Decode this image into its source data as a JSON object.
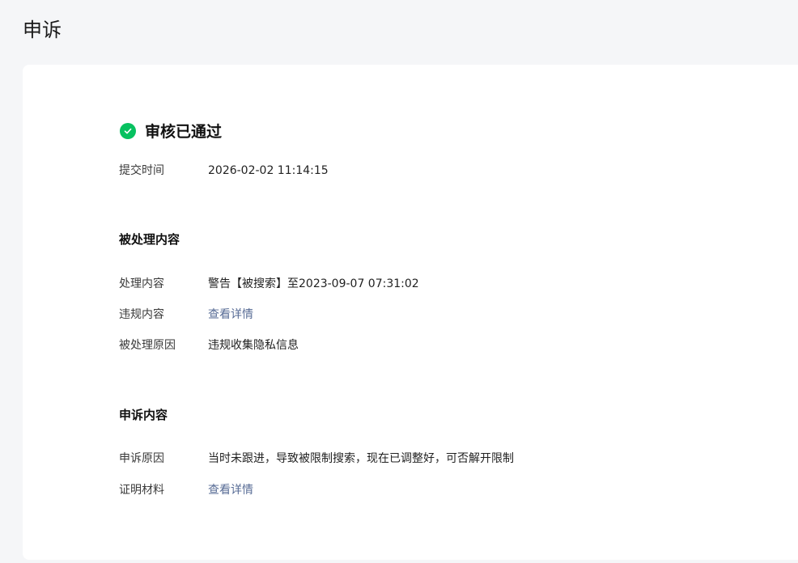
{
  "page": {
    "title": "申诉"
  },
  "status": {
    "text": "审核已通过",
    "color": "#07c160"
  },
  "submit": {
    "label": "提交时间",
    "value": "2026-02-02 11:14:15"
  },
  "processed": {
    "title": "被处理内容",
    "content_label": "处理内容",
    "content_value": "警告【被搜索】至2023-09-07 07:31:02",
    "violation_label": "违规内容",
    "violation_link": "查看详情",
    "reason_label": "被处理原因",
    "reason_value": "违规收集隐私信息"
  },
  "appeal": {
    "title": "申诉内容",
    "reason_label": "申诉原因",
    "reason_value": "当时未跟进，导致被限制搜索，现在已调整好，可否解开限制",
    "proof_label": "证明材料",
    "proof_link": "查看详情"
  },
  "link_color": "#576b95"
}
